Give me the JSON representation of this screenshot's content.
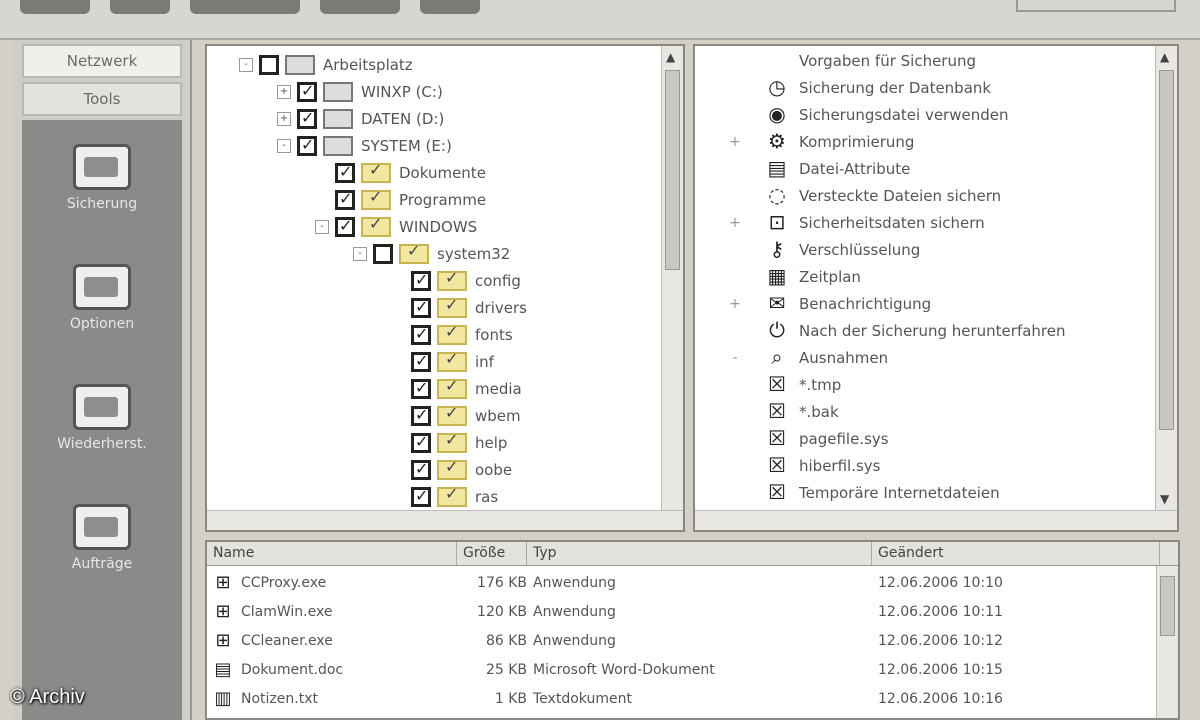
{
  "top": {
    "right_label": ""
  },
  "sidebar": {
    "tab_1": "Netzwerk",
    "tab_2": "Tools",
    "tools": [
      {
        "label": "Sicherung",
        "icon": "drive-icon"
      },
      {
        "label": "Optionen",
        "icon": "settings-icon"
      },
      {
        "label": "Wiederherst.",
        "icon": "restore-icon"
      },
      {
        "label": "Aufträge",
        "icon": "jobs-icon"
      }
    ]
  },
  "tree": {
    "rows": [
      {
        "label": "Arbeitsplatz",
        "icon": "computer-icon",
        "level": 0,
        "checked": false,
        "expander": "-"
      },
      {
        "label": "WINXP (C:)",
        "icon": "drive-icon",
        "level": 1,
        "checked": true,
        "expander": "+"
      },
      {
        "label": "DATEN (D:)",
        "icon": "drive-icon",
        "level": 1,
        "checked": true,
        "expander": "+"
      },
      {
        "label": "SYSTEM (E:)",
        "icon": "drive-icon",
        "level": 1,
        "checked": true,
        "expander": "-"
      },
      {
        "label": "Dokumente",
        "icon": "folder-icon",
        "level": 2,
        "checked": true,
        "expander": ""
      },
      {
        "label": "Programme",
        "icon": "folder-icon",
        "level": 2,
        "checked": true,
        "expander": ""
      },
      {
        "label": "WINDOWS",
        "icon": "folder-icon",
        "level": 2,
        "checked": true,
        "expander": "-"
      },
      {
        "label": "system32",
        "icon": "folder-icon",
        "level": 3,
        "checked": false,
        "expander": "-"
      },
      {
        "label": "config",
        "icon": "folder-icon",
        "level": 4,
        "checked": true,
        "expander": ""
      },
      {
        "label": "drivers",
        "icon": "folder-icon",
        "level": 4,
        "checked": true,
        "expander": ""
      },
      {
        "label": "fonts",
        "icon": "folder-icon",
        "level": 4,
        "checked": true,
        "expander": ""
      },
      {
        "label": "inf",
        "icon": "folder-icon",
        "level": 4,
        "checked": true,
        "expander": ""
      },
      {
        "label": "media",
        "icon": "folder-icon",
        "level": 4,
        "checked": true,
        "expander": ""
      },
      {
        "label": "wbem",
        "icon": "folder-icon",
        "level": 4,
        "checked": true,
        "expander": ""
      },
      {
        "label": "help",
        "icon": "folder-icon",
        "level": 4,
        "checked": true,
        "expander": ""
      },
      {
        "label": "oobe",
        "icon": "folder-icon",
        "level": 4,
        "checked": true,
        "expander": ""
      },
      {
        "label": "ras",
        "icon": "folder-icon",
        "level": 4,
        "checked": true,
        "expander": ""
      }
    ]
  },
  "actions": {
    "rows": [
      {
        "label": "Vorgaben für Sicherung",
        "icon": "",
        "expander": ""
      },
      {
        "label": "Sicherung der Datenbank",
        "icon": "clock-icon",
        "expander": ""
      },
      {
        "label": "Sicherungsdatei verwenden",
        "icon": "disk-icon",
        "expander": ""
      },
      {
        "label": "Komprimierung",
        "icon": "gear-icon",
        "expander": "+"
      },
      {
        "label": "Datei-Attribute",
        "icon": "file-icon",
        "expander": ""
      },
      {
        "label": "Versteckte Dateien sichern",
        "icon": "hidden-icon",
        "expander": ""
      },
      {
        "label": "Sicherheitsdaten sichern",
        "icon": "lock-icon",
        "expander": "+"
      },
      {
        "label": "Verschlüsselung",
        "icon": "key-icon",
        "expander": ""
      },
      {
        "label": "Zeitplan",
        "icon": "calendar-icon",
        "expander": ""
      },
      {
        "label": "Benachrichtigung",
        "icon": "mail-icon",
        "expander": "+"
      },
      {
        "label": "Nach der Sicherung herunterfahren",
        "icon": "power-icon",
        "expander": ""
      },
      {
        "label": "Ausnahmen",
        "icon": "search-icon",
        "expander": "-"
      },
      {
        "label": "*.tmp",
        "icon": "cross-icon",
        "expander": ""
      },
      {
        "label": "*.bak",
        "icon": "cross-icon",
        "expander": ""
      },
      {
        "label": "pagefile.sys",
        "icon": "cross-icon",
        "expander": ""
      },
      {
        "label": "hiberfil.sys",
        "icon": "cross-icon",
        "expander": ""
      },
      {
        "label": "Temporäre Internetdateien",
        "icon": "cross-icon",
        "expander": ""
      }
    ]
  },
  "list": {
    "headers": {
      "name": "Name",
      "size": "Größe",
      "type": "Typ",
      "modified": "Geändert"
    },
    "rows": [
      {
        "name": "CCProxy.exe",
        "size": "176 KB",
        "type": "Anwendung",
        "modified": "12.06.2006 10:10",
        "icon": "app-icon"
      },
      {
        "name": "ClamWin.exe",
        "size": "120 KB",
        "type": "Anwendung",
        "modified": "12.06.2006 10:11",
        "icon": "app-icon"
      },
      {
        "name": "CCleaner.exe",
        "size": "86 KB",
        "type": "Anwendung",
        "modified": "12.06.2006 10:12",
        "icon": "app-icon"
      },
      {
        "name": "Dokument.doc",
        "size": "25 KB",
        "type": "Microsoft Word-Dokument",
        "modified": "12.06.2006 10:15",
        "icon": "doc-icon"
      },
      {
        "name": "Notizen.txt",
        "size": "1 KB",
        "type": "Textdokument",
        "modified": "12.06.2006 10:16",
        "icon": "text-icon"
      }
    ]
  },
  "credit": "© Archiv"
}
